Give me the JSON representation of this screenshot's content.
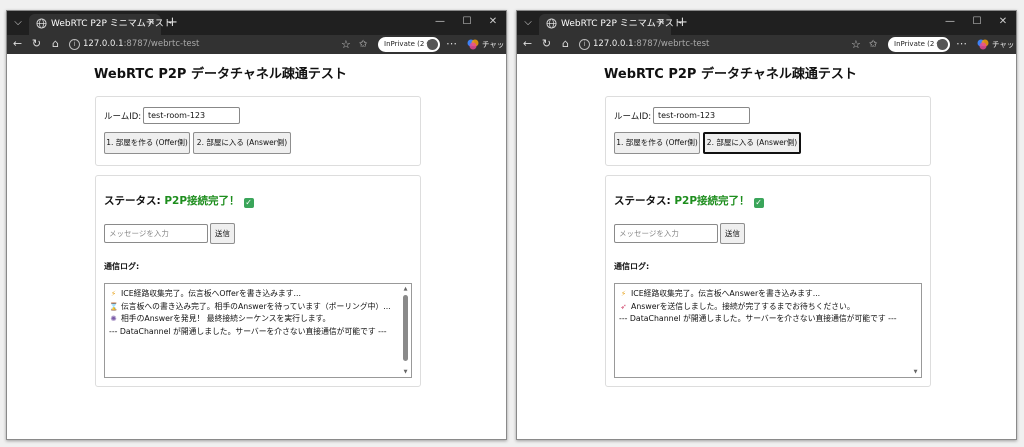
{
  "windows": [
    {
      "browser": {
        "tab_title": "WebRTC P2P ミニマムテスト",
        "url_host": "127.0.0.1",
        "url_path": ":8787/webrtc-test",
        "inprivate_label": "InPrivate (2 個)",
        "chat_label": "チャット"
      },
      "page": {
        "title": "WebRTC P2P データチャネル疎通テスト",
        "room_label": "ルームID:",
        "room_value": "test-room-123",
        "create_button": "1. 部屋を作る (Offer側)",
        "join_button": "2. 部屋に入る (Answer側)",
        "status_label": "ステータス: ",
        "status_value": "P2P接続完了！",
        "message_placeholder": "メッセージを入力",
        "send_button": "送信",
        "log_title": "通信ログ:",
        "log": [
          {
            "icon": "lightning-icon",
            "text": "ICE経路収集完了。伝言板へOfferを書き込みます..."
          },
          {
            "icon": "hourglass-icon",
            "text": "伝言板への書き込み完了。相手のAnswerを待っています（ポーリング中）..."
          },
          {
            "icon": "sparkle-icon",
            "text": "相手のAnswerを発見！ 最終接続シーケンスを実行します。"
          },
          {
            "icon": "",
            "text": "--- DataChannel が開通しました。サーバーを介さない直接通信が可能です ---"
          }
        ]
      }
    },
    {
      "browser": {
        "tab_title": "WebRTC P2P ミニマムテスト",
        "url_host": "127.0.0.1",
        "url_path": ":8787/webrtc-test",
        "inprivate_label": "InPrivate (2 個)",
        "chat_label": "チャット"
      },
      "page": {
        "title": "WebRTC P2P データチャネル疎通テスト",
        "room_label": "ルームID:",
        "room_value": "test-room-123",
        "create_button": "1. 部屋を作る (Offer側)",
        "join_button": "2. 部屋に入る (Answer側)",
        "status_label": "ステータス: ",
        "status_value": "P2P接続完了！",
        "message_placeholder": "メッセージを入力",
        "send_button": "送信",
        "log_title": "通信ログ:",
        "log": [
          {
            "icon": "lightning-icon",
            "text": "ICE経路収集完了。伝言板へAnswerを書き込みます..."
          },
          {
            "icon": "rocket-icon",
            "text": "Answerを送信しました。接続が完了するまでお待ちください。"
          },
          {
            "icon": "",
            "text": "--- DataChannel が開通しました。サーバーを介さない直接通信が可能です ---"
          }
        ]
      }
    }
  ],
  "colors": {
    "status_ok": "#1e8e1e",
    "chrome_dark": "#202020",
    "toolbar_dark": "#323232"
  }
}
